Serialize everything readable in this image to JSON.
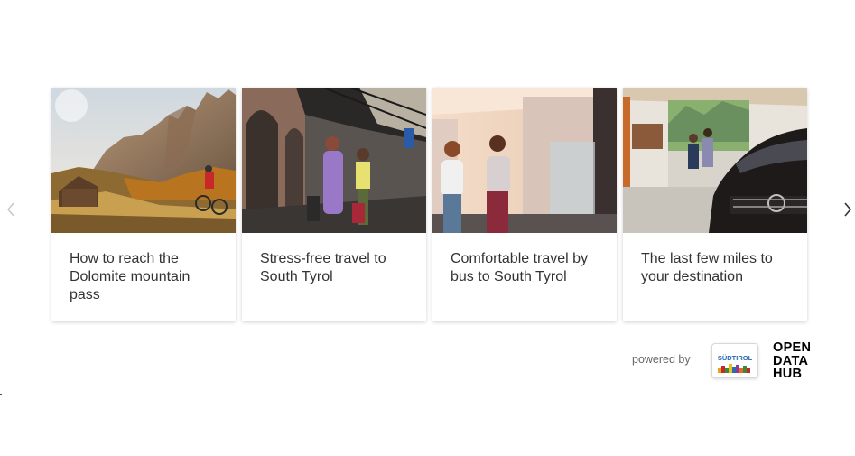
{
  "carousel": {
    "prev_icon": "chevron-left-icon",
    "next_icon": "chevron-right-icon",
    "cards": [
      {
        "title": "How to reach the Dolomite mountain pass",
        "image": "mountain-cyclist-photo"
      },
      {
        "title": "Stress-free travel to South Tyrol",
        "image": "train-station-couple-photo"
      },
      {
        "title": "Comfortable travel by bus to South Tyrol",
        "image": "bus-women-photo"
      },
      {
        "title": "The last few miles to your destination",
        "image": "car-station-photo"
      }
    ]
  },
  "footer": {
    "powered_by": "powered by",
    "sudtirol_logo_text": "SÜDTIROL",
    "odh_line1": "OPEN",
    "odh_line2": "DATA",
    "odh_line3": "HUB"
  }
}
